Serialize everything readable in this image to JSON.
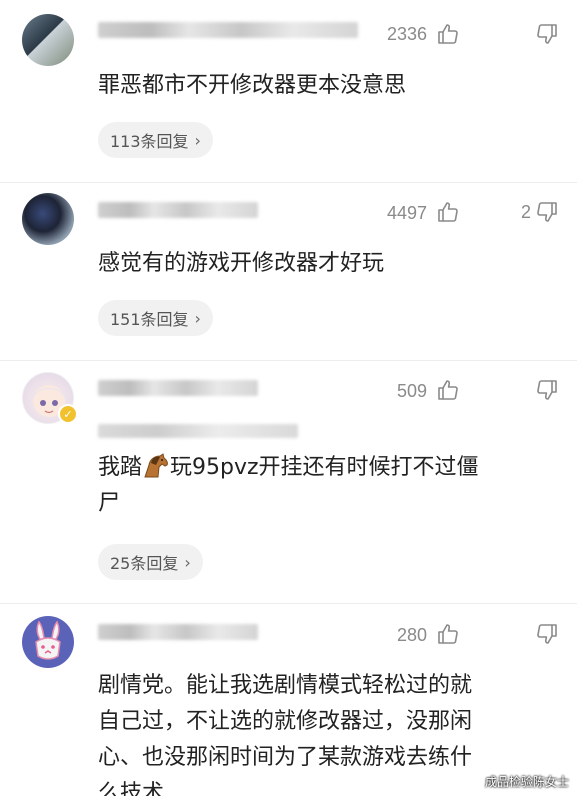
{
  "comments": [
    {
      "likes": "2336",
      "dislikes": "",
      "text": "罪恶都市不开修改器更本没意思",
      "replies": "113条回复",
      "verified": false
    },
    {
      "likes": "4497",
      "dislikes": "2",
      "text": "感觉有的游戏开修改器才好玩",
      "replies": "151条回复",
      "verified": false
    },
    {
      "likes": "509",
      "dislikes": "",
      "text_before": "我踏",
      "text_after": "玩95pvz开挂还有时候打不过僵",
      "text_line2": "尸",
      "replies": "25条回复",
      "verified": true
    },
    {
      "likes": "280",
      "dislikes": "",
      "text_lines": [
        "剧情党。能让我选剧情模式轻松过的就",
        "自己过，不让选的就修改器过，没那闲",
        "心、也没那闲时间为了某款游戏去练什",
        "么技术"
      ],
      "replies": "",
      "verified": false
    }
  ],
  "icons": {
    "like": "thumbs-up-icon",
    "dislike": "thumbs-down-icon",
    "chevron": "chevron-right-icon",
    "emoji": "horse-emoji"
  },
  "chevron_glyph": "›",
  "watermark": "成品检验陈女士"
}
